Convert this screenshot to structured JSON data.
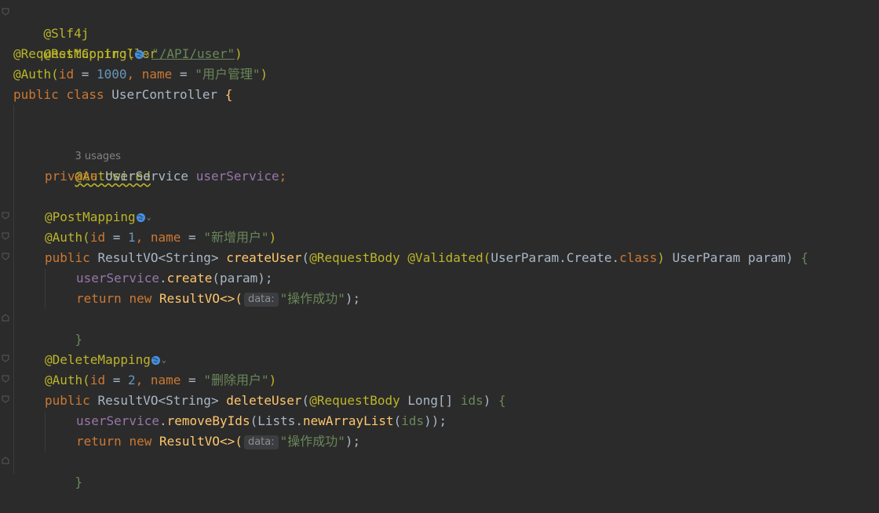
{
  "editor": {
    "line1": {
      "ann": "@Slf4j"
    },
    "line2": {
      "ann": "@RestController"
    },
    "line3": {
      "ann": "@RequestMapping(",
      "url": "\"/API/user\"",
      "close": ")"
    },
    "line4": {
      "ann": "@Auth",
      "open": "(",
      "k1": "id",
      "eq1": " = ",
      "v1": "1000",
      "sep": ", ",
      "k2": "name",
      "eq2": " = ",
      "v2": "\"用户管理\"",
      "close": ")"
    },
    "line5": {
      "kw1": "public",
      "kw2": "class",
      "cls": "UserController",
      "brace": "{"
    },
    "line6": {
      "usages": "3 usages"
    },
    "line7": {
      "ann": "@Autowired"
    },
    "line8": {
      "kw": "private",
      "type": "UserService",
      "field": "userService",
      "semi": ";"
    },
    "line9": {
      "ann": "@PostMapping"
    },
    "line10": {
      "ann": "@Auth",
      "open": "(",
      "k1": "id",
      "eq1": " = ",
      "v1": "1",
      "sep": ", ",
      "k2": "name",
      "eq2": " = ",
      "v2": "\"新增用户\"",
      "close": ")"
    },
    "line11": {
      "kw": "public",
      "type": "ResultVO",
      "generic_open": "<",
      "generic": "String",
      "generic_close": ">",
      "method": "createUser",
      "open": "(",
      "ann1": "@RequestBody",
      "ann2": "@Validated",
      "arg_open": "(",
      "arg": "UserParam.Create.",
      "arg_kw": "class",
      "arg_close": ")",
      "ptype": "UserParam",
      "pname": "param",
      "close": ")",
      "brace": "{"
    },
    "line12": {
      "field": "userService",
      "dot": ".",
      "call": "create",
      "open": "(",
      "arg": "param",
      "close": ");"
    },
    "line13": {
      "kw1": "return",
      "kw2": "new",
      "type": "ResultVO",
      "diamond": "<>(",
      "hint": "data:",
      "str": "\"操作成功\"",
      "close": ");"
    },
    "line14": {
      "brace": "}"
    },
    "line15": {
      "ann": "@DeleteMapping"
    },
    "line16": {
      "ann": "@Auth",
      "open": "(",
      "k1": "id",
      "eq1": " = ",
      "v1": "2",
      "sep": ", ",
      "k2": "name",
      "eq2": " = ",
      "v2": "\"删除用户\"",
      "close": ")"
    },
    "line17": {
      "kw": "public",
      "type": "ResultVO",
      "generic_open": "<",
      "generic": "String",
      "generic_close": ">",
      "method": "deleteUser",
      "open": "(",
      "ann1": "@RequestBody",
      "ptype": "Long[]",
      "pname": "ids",
      "close": ")",
      "brace": "{"
    },
    "line18": {
      "field": "userService",
      "dot": ".",
      "call": "removeByIds",
      "open": "(",
      "cls": "Lists",
      "dot2": ".",
      "call2": "newArrayList",
      "open2": "(",
      "arg": "ids",
      "close": "));"
    },
    "line19": {
      "kw1": "return",
      "kw2": "new",
      "type": "ResultVO",
      "diamond": "<>(",
      "hint": "data:",
      "str": "\"操作成功\"",
      "close": ");"
    },
    "line20": {
      "brace": "}"
    }
  },
  "icons": {
    "endpoint": "globe-icon",
    "dropdown": "chevron-down-icon"
  },
  "colors": {
    "background": "#2b2b2b",
    "annotation": "#bbb529",
    "keyword": "#cc7832",
    "number": "#6897bb",
    "string": "#6a8759",
    "field": "#9876aa",
    "method": "#ffc66d"
  }
}
